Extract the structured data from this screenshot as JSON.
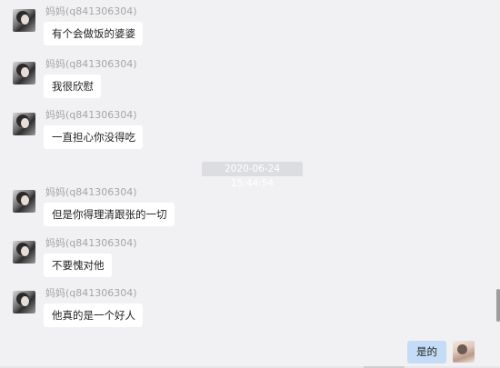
{
  "conversation": {
    "messages": [
      {
        "sender": "妈妈(q841306304)",
        "text": "有个会做饭的婆婆"
      },
      {
        "sender": "妈妈(q841306304)",
        "text": "我很欣慰"
      },
      {
        "sender": "妈妈(q841306304)",
        "text": "一直担心你没得吃"
      },
      {
        "sender": "妈妈(q841306304)",
        "text": "但是你得理清跟张的一切"
      },
      {
        "sender": "妈妈(q841306304)",
        "text": "不要愧对他"
      },
      {
        "sender": "妈妈(q841306304)",
        "text": "他真的是一个好人"
      }
    ],
    "timestamp": "2020-06-24 15:44:54",
    "own_message": {
      "text": "是的"
    }
  },
  "colors": {
    "background": "#f1f1f3",
    "incoming_bubble": "#ffffff",
    "outgoing_bubble": "#c4dcf6",
    "timestamp_bg": "#dcdde0",
    "sender_text": "#a5a5a5"
  },
  "icons": {
    "contact_avatar": "mother-avatar",
    "own_avatar": "self-avatar"
  }
}
